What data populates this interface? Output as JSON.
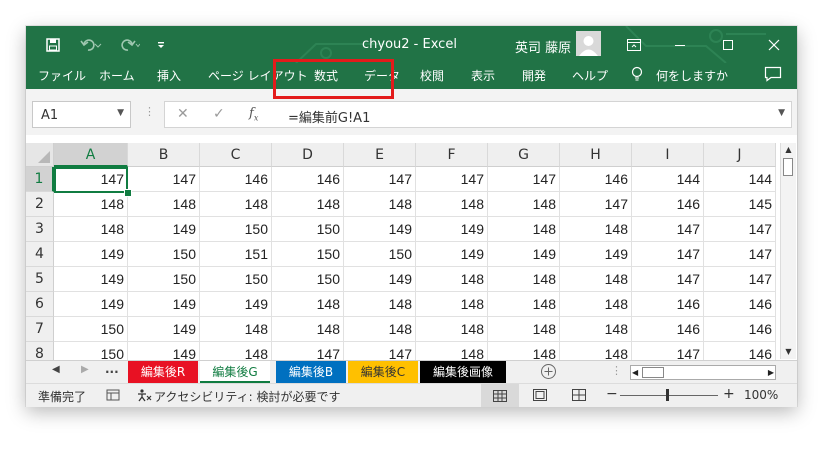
{
  "app": {
    "title": "chyou2  -  Excel",
    "user": "英司 藤原",
    "accent": "#217346"
  },
  "quick_access": [
    "save-icon",
    "undo-icon",
    "redo-icon",
    "customize-icon"
  ],
  "window_buttons": [
    "ribbon-display-icon",
    "minimize-icon",
    "maximize-icon",
    "close-icon"
  ],
  "menu": {
    "items": [
      "ファイル",
      "ホーム",
      "挿入",
      "ページ レイアウト",
      "数式",
      "データ",
      "校閲",
      "表示",
      "開発",
      "ヘルプ"
    ],
    "tell_me": "何をしますか"
  },
  "formula_bar": {
    "name_box": "A1",
    "formula": "=編集前G!A1",
    "highlight_color": "#e31b1b"
  },
  "grid": {
    "columns": [
      "A",
      "B",
      "C",
      "D",
      "E",
      "F",
      "G",
      "H",
      "I",
      "J"
    ],
    "rows": [
      {
        "label": "1",
        "cells": [
          "147",
          "147",
          "146",
          "146",
          "147",
          "147",
          "147",
          "146",
          "144",
          "144"
        ]
      },
      {
        "label": "2",
        "cells": [
          "148",
          "148",
          "148",
          "148",
          "148",
          "148",
          "148",
          "147",
          "146",
          "145"
        ]
      },
      {
        "label": "3",
        "cells": [
          "148",
          "149",
          "150",
          "150",
          "149",
          "149",
          "148",
          "148",
          "147",
          "147"
        ]
      },
      {
        "label": "4",
        "cells": [
          "149",
          "150",
          "151",
          "150",
          "150",
          "149",
          "149",
          "149",
          "147",
          "147"
        ]
      },
      {
        "label": "5",
        "cells": [
          "149",
          "150",
          "150",
          "150",
          "149",
          "148",
          "148",
          "148",
          "147",
          "147"
        ]
      },
      {
        "label": "6",
        "cells": [
          "149",
          "149",
          "149",
          "148",
          "148",
          "148",
          "148",
          "148",
          "146",
          "146"
        ]
      },
      {
        "label": "7",
        "cells": [
          "150",
          "149",
          "148",
          "148",
          "148",
          "148",
          "148",
          "148",
          "146",
          "146"
        ]
      },
      {
        "label": "8",
        "cells": [
          "150",
          "149",
          "148",
          "147",
          "147",
          "148",
          "148",
          "148",
          "147",
          "146"
        ]
      }
    ],
    "active_cell": "A1"
  },
  "sheet_tabs": {
    "more": "...",
    "tabs": [
      {
        "label": "編集後R",
        "bg": "#e81123",
        "fg": "#ffffff",
        "active": false
      },
      {
        "label": "編集後G",
        "bg": "#ffffff",
        "fg": "#107c41",
        "active": true
      },
      {
        "label": "編集後B",
        "bg": "#0070c0",
        "fg": "#ffffff",
        "active": false
      },
      {
        "label": "編集後C",
        "bg": "#ffc000",
        "fg": "#333333",
        "active": false
      },
      {
        "label": "編集後画像",
        "bg": "#000000",
        "fg": "#ffffff",
        "active": false
      }
    ]
  },
  "status": {
    "ready": "準備完了",
    "accessibility": "アクセシビリティ: 検討が必要です",
    "zoom": "100%",
    "zoom_minus": "−",
    "zoom_plus": "+"
  }
}
